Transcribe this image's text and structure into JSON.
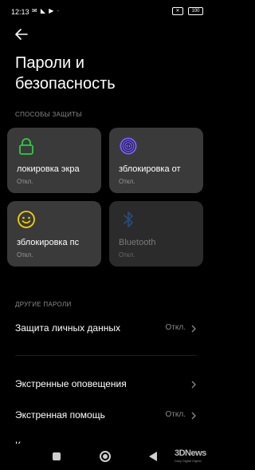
{
  "status_bar": {
    "time": "12:13",
    "icons": "✉ ◣ ▶ ·",
    "sim_label": "✕",
    "battery": "100"
  },
  "page": {
    "title_line1": "Пароли и",
    "title_line2": "безопасность"
  },
  "protection": {
    "section_label": "СПОСОБЫ ЗАЩИТЫ",
    "tiles": [
      {
        "name": "локировка экра",
        "state": "Откл.",
        "icon": "lock-icon",
        "color": "#2ecc40"
      },
      {
        "name": "зблокировка от",
        "state": "Откл.",
        "icon": "fingerprint-icon",
        "color": "#7b61ff"
      },
      {
        "name": "зблокировка пс",
        "state": "Откл.",
        "icon": "face-icon",
        "color": "#f5d000"
      },
      {
        "name": "Bluetooth",
        "state": "Откл.",
        "icon": "bluetooth-icon",
        "color": "#2a4a7a"
      }
    ]
  },
  "other": {
    "section_label": "ДРУГИЕ ПАРОЛИ",
    "privacy_label": "Защита личных данных",
    "privacy_value": "Откл."
  },
  "emergency": {
    "alerts_label": "Экстренные оповещения",
    "sos_label": "Экстренная помощь",
    "sos_value": "Откл.",
    "partial_label": "К"
  },
  "watermark": {
    "main": "3DNews",
    "sub": "Daily Digital Digest"
  }
}
